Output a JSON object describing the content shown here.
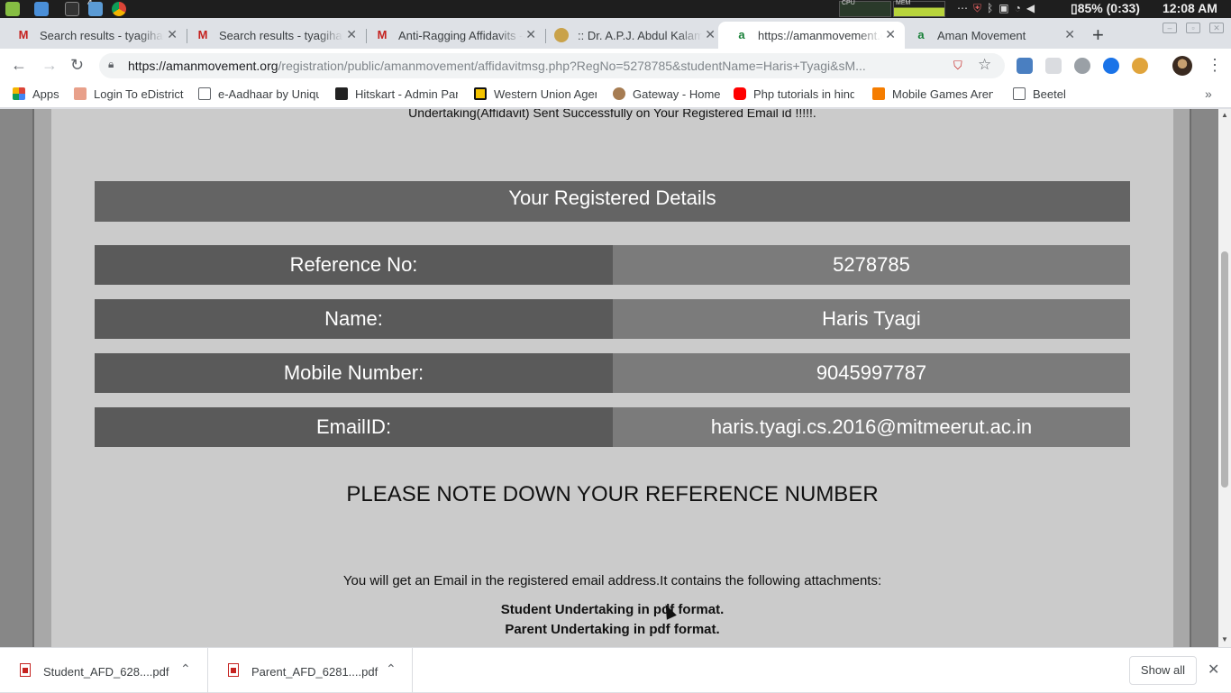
{
  "os": {
    "workspace_badge": "4",
    "cpu_label": "CPU",
    "mem_label": "MEM",
    "battery": "85% (0:33)",
    "clock": "12:08 AM",
    "tray_icons": [
      "more-icon",
      "shield-icon",
      "bluetooth-icon",
      "clipboard-icon",
      "wifi-icon",
      "volume-icon",
      "battery-icon"
    ]
  },
  "tabs": [
    {
      "title": "Search results - tyagiharis",
      "favicon": "gmail-icon",
      "active": false
    },
    {
      "title": "Search results - tyagiharis",
      "favicon": "gmail-icon",
      "active": false
    },
    {
      "title": "Anti-Ragging Affidavits - ",
      "favicon": "gmail-icon",
      "active": false
    },
    {
      "title": ":: Dr. A.P.J. Abdul Kalam T",
      "favicon": "university-seal-icon",
      "active": false
    },
    {
      "title": "https://amanmovement.org",
      "favicon": "aman-icon",
      "active": true
    },
    {
      "title": "Aman Movement",
      "favicon": "aman-icon",
      "active": false
    }
  ],
  "toolbar": {
    "url_domain": "https://amanmovement.org",
    "url_path": "/registration/public/amanmovement/affidavitmsg.php?RegNo=5278785&studentName=Haris+Tyagi&sM..."
  },
  "bookmarks": [
    {
      "label": "Apps",
      "icon": "apps-grid-icon"
    },
    {
      "label": "Login To eDistrict",
      "icon": "edistrict-icon"
    },
    {
      "label": "e-Aadhaar by Unique",
      "icon": "page-icon"
    },
    {
      "label": "Hitskart - Admin Pan",
      "icon": "hitskart-icon"
    },
    {
      "label": "Western Union Agen",
      "icon": "western-union-icon"
    },
    {
      "label": "Gateway - Home",
      "icon": "gateway-icon"
    },
    {
      "label": "Php tutorials in hindi",
      "icon": "youtube-icon"
    },
    {
      "label": "Mobile Games Arena",
      "icon": "blogger-icon"
    },
    {
      "label": "Beetel",
      "icon": "page-icon"
    }
  ],
  "page": {
    "top_message": "Undertaking(Affidavit) Sent Successfully on Your Registered Email id !!!!!.",
    "details_title": "Your Registered Details",
    "details": [
      {
        "label": "Reference No:",
        "value": "5278785"
      },
      {
        "label": "Name:",
        "value": "Haris Tyagi"
      },
      {
        "label": "Mobile Number:",
        "value": "9045997787"
      },
      {
        "label": "EmailID:",
        "value": "haris.tyagi.cs.2016@mitmeerut.ac.in"
      }
    ],
    "note": "PLEASE NOTE DOWN YOUR REFERENCE NUMBER",
    "email_info": "You will get an Email in the registered email address.It contains the following attachments:",
    "attachments": [
      "Student Undertaking in pdf format.",
      "Parent Undertaking in pdf format."
    ]
  },
  "downloads": {
    "items": [
      {
        "name": "Student_AFD_628....pdf"
      },
      {
        "name": "Parent_AFD_6281....pdf"
      }
    ],
    "show_all": "Show all"
  }
}
